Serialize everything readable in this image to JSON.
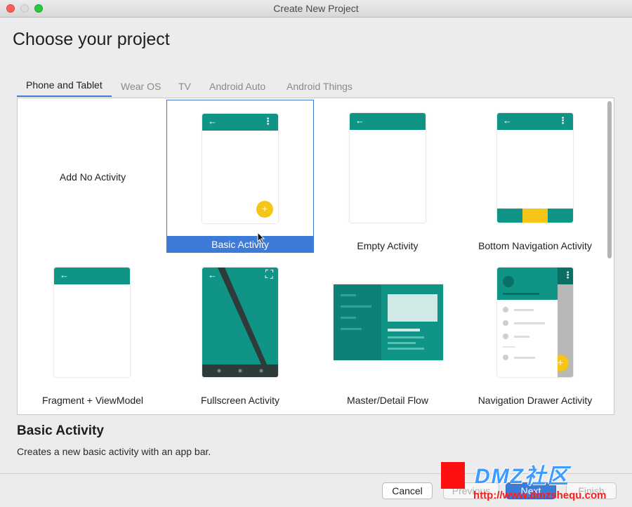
{
  "window": {
    "title": "Create New Project"
  },
  "page": {
    "heading": "Choose your project"
  },
  "tabs": [
    {
      "label": "Phone and Tablet"
    },
    {
      "label": "Wear OS"
    },
    {
      "label": "TV"
    },
    {
      "label": "Android Auto"
    },
    {
      "label": "Android Things"
    }
  ],
  "templates": [
    {
      "label": "Add No Activity"
    },
    {
      "label": "Basic Activity"
    },
    {
      "label": "Empty Activity"
    },
    {
      "label": "Bottom Navigation Activity"
    },
    {
      "label": "Fragment + ViewModel"
    },
    {
      "label": "Fullscreen Activity"
    },
    {
      "label": "Master/Detail Flow"
    },
    {
      "label": "Navigation Drawer Activity"
    }
  ],
  "selected": {
    "title": "Basic Activity",
    "description": "Creates a new basic activity with an app bar."
  },
  "buttons": {
    "cancel": "Cancel",
    "previous": "Previous",
    "next": "Next",
    "finish": "Finish"
  },
  "icons": {
    "back": "←",
    "overflow": "⋮",
    "fab": "+",
    "fullscreen": "⛶"
  },
  "watermark": {
    "logo": "DMZ社区",
    "url": "http://www.dmzshequ.com"
  },
  "colors": {
    "teal": "#0f9486",
    "accent": "#3d7bd8",
    "fab": "#f5c518"
  }
}
